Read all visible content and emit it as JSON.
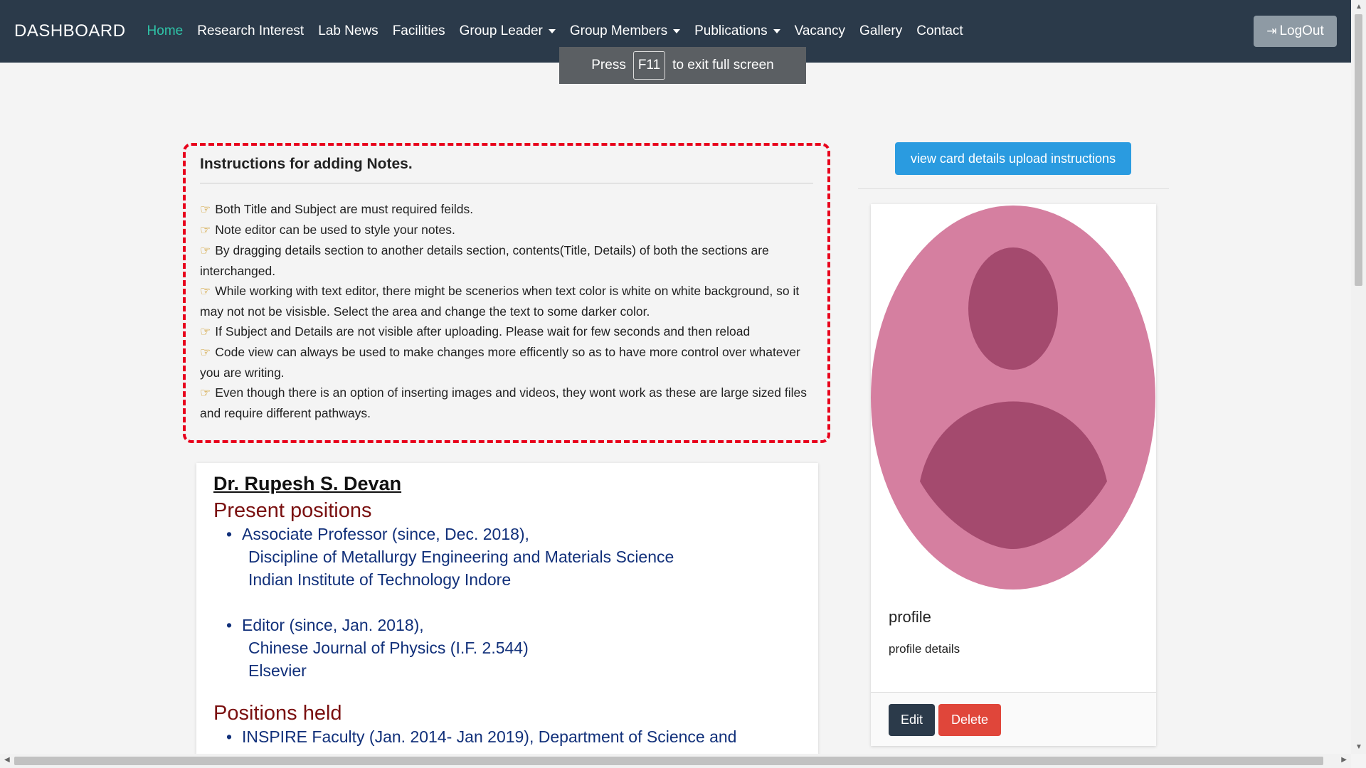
{
  "nav": {
    "brand": "DASHBOARD",
    "items": [
      {
        "label": "Home",
        "active": true,
        "dropdown": false
      },
      {
        "label": "Research Interest",
        "active": false,
        "dropdown": false
      },
      {
        "label": "Lab News",
        "active": false,
        "dropdown": false
      },
      {
        "label": "Facilities",
        "active": false,
        "dropdown": false
      },
      {
        "label": "Group Leader",
        "active": false,
        "dropdown": true
      },
      {
        "label": "Group Members",
        "active": false,
        "dropdown": true
      },
      {
        "label": "Publications",
        "active": false,
        "dropdown": true
      },
      {
        "label": "Vacancy",
        "active": false,
        "dropdown": false
      },
      {
        "label": "Gallery",
        "active": false,
        "dropdown": false
      },
      {
        "label": "Contact",
        "active": false,
        "dropdown": false
      }
    ],
    "logout_label": "LogOut",
    "active_color": "#2fc4a8"
  },
  "fullscreen_tip": {
    "press": "Press",
    "key": "F11",
    "rest": "to exit full screen"
  },
  "instructions": {
    "title": "Instructions for adding Notes.",
    "lines": [
      "Both Title and Subject are must required feilds.",
      "Note editor can be used to style your notes.",
      "By dragging details section to another details section, contents(Title, Details) of both the sections are interchanged.",
      "While working with text editor, there might be scenerios when text color is white on white background, so it may not not be visisble. Select the area and change the text to some darker color.",
      "If Subject and Details are not visible after uploading. Please wait for few seconds and then reload",
      "Code view can always be used to make changes more efficently so as to have more control over whatever you are writing.",
      "Even though there is an option of inserting images and videos, they wont work as these are large sized files and require different pathways."
    ],
    "border_color": "#e8001c"
  },
  "profile": {
    "name": "Dr. Rupesh S. Devan",
    "present_title": "Present positions",
    "present": [
      {
        "role": "Associate Professor (since, Dec. 2018),",
        "lines": [
          "Discipline of Metallurgy Engineering and Materials Science",
          "Indian Institute of Technology Indore"
        ]
      },
      {
        "role": "Editor (since, Jan. 2018),",
        "lines": [
          "Chinese Journal of Physics (I.F. 2.544)",
          "Elsevier"
        ]
      }
    ],
    "held_title": "Positions held",
    "held": [
      "INSPIRE Faculty (Jan. 2014- Jan 2019), Department of Science and"
    ]
  },
  "sidebar": {
    "view_button": "view card details upload instructions",
    "card_title": "profile",
    "card_text": "profile details",
    "edit_label": "Edit",
    "delete_label": "Delete"
  }
}
